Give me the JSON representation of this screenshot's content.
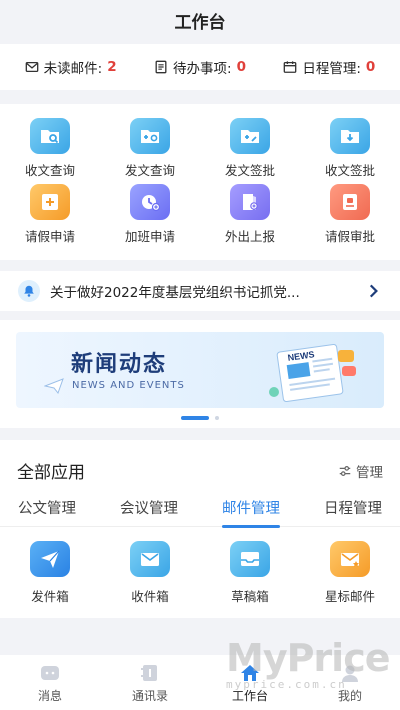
{
  "header": {
    "title": "工作台"
  },
  "stats": [
    {
      "icon": "mail-icon",
      "label": "未读邮件:",
      "count": "2"
    },
    {
      "icon": "todo-list-icon",
      "label": "待办事项:",
      "count": "0"
    },
    {
      "icon": "calendar-icon",
      "label": "日程管理:",
      "count": "0"
    }
  ],
  "quick_actions": [
    {
      "label": "收文查询",
      "icon": "folder-search-icon"
    },
    {
      "label": "发文查询",
      "icon": "folder-search-icon"
    },
    {
      "label": "发文签批",
      "icon": "folder-sign-icon"
    },
    {
      "label": "收文签批",
      "icon": "folder-download-icon"
    },
    {
      "label": "请假申请",
      "icon": "leave-request-icon"
    },
    {
      "label": "加班申请",
      "icon": "overtime-icon"
    },
    {
      "label": "外出上报",
      "icon": "book-add-icon"
    },
    {
      "label": "请假审批",
      "icon": "approval-icon"
    }
  ],
  "notice": {
    "text": "关于做好2022年度基层党组织书记抓党..."
  },
  "banner": {
    "title": "新闻动态",
    "subtitle": "NEWS AND EVENTS",
    "paper_text": "NEWS"
  },
  "apps": {
    "title": "全部应用",
    "manage_label": "管理",
    "tabs": [
      "公文管理",
      "会议管理",
      "邮件管理",
      "日程管理"
    ],
    "active_tab": 2,
    "items": [
      {
        "label": "发件箱",
        "icon": "paper-plane-icon"
      },
      {
        "label": "收件箱",
        "icon": "inbox-icon"
      },
      {
        "label": "草稿箱",
        "icon": "drafts-icon"
      },
      {
        "label": "星标邮件",
        "icon": "star-mail-icon"
      }
    ]
  },
  "bottom_nav": [
    {
      "label": "消息",
      "icon": "message-icon"
    },
    {
      "label": "通讯录",
      "icon": "contacts-icon"
    },
    {
      "label": "工作台",
      "icon": "home-icon",
      "active": true
    },
    {
      "label": "我的",
      "icon": "user-icon"
    }
  ],
  "watermark": {
    "text": "MyPrice",
    "subtext": "myprice.com.cn"
  },
  "colors": {
    "accent": "#2f84e6",
    "count": "#e0403a",
    "background": "#f2f3f7"
  }
}
